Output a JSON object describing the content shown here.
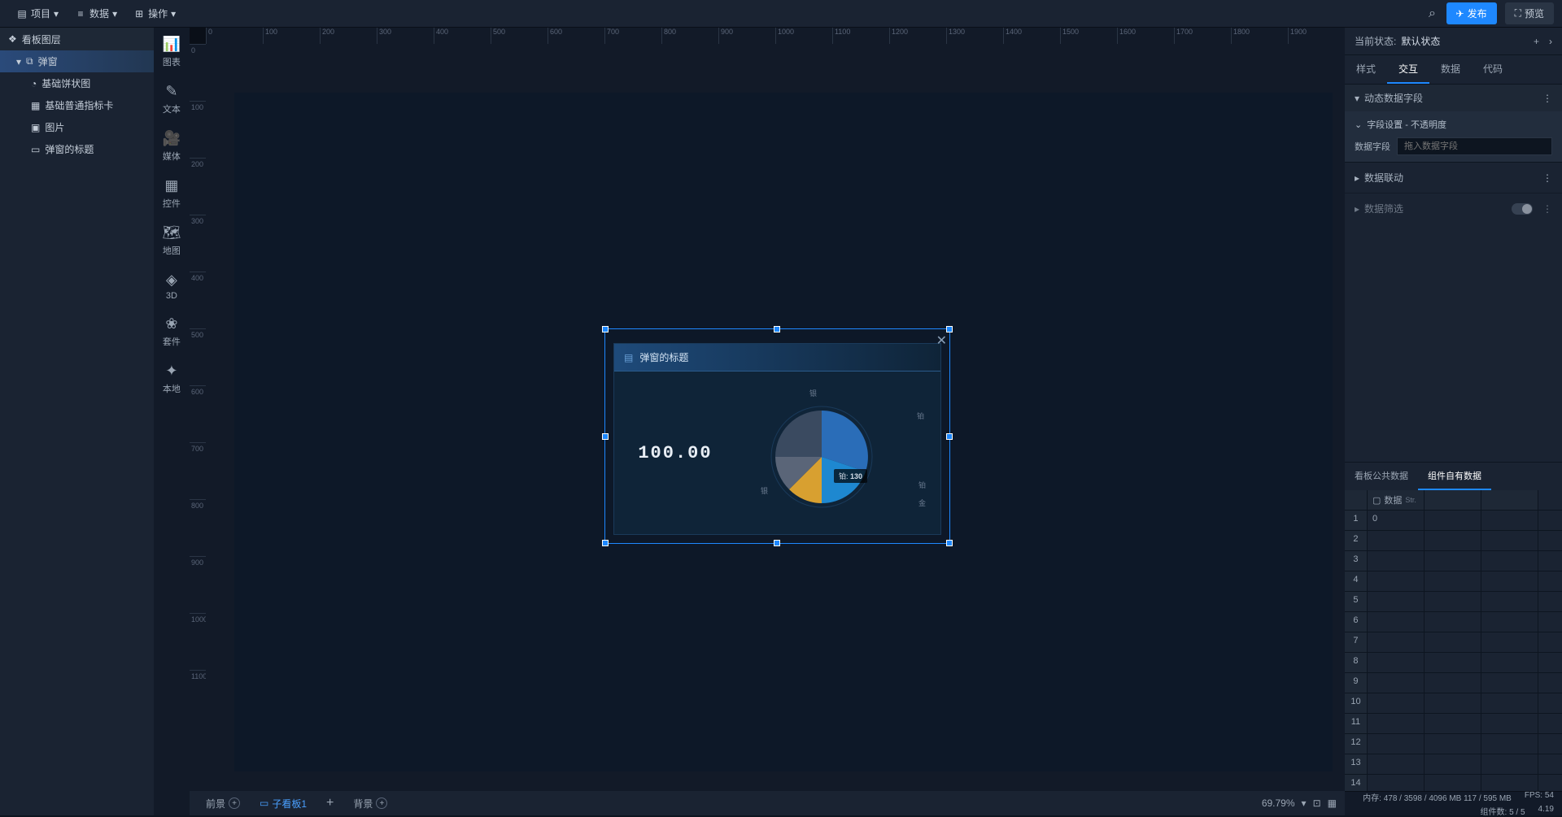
{
  "top_menu": {
    "project": "项目",
    "data": "数据",
    "actions": "操作",
    "publish": "发布",
    "preview": "预览"
  },
  "left_panel": {
    "layers_title": "看板图层",
    "tree": {
      "root": "弹窗",
      "children": [
        "基础饼状图",
        "基础普通指标卡",
        "图片",
        "弹窗的标题"
      ]
    }
  },
  "component_strip": [
    "图表",
    "文本",
    "媒体",
    "控件",
    "地图",
    "3D",
    "套件",
    "本地"
  ],
  "canvas": {
    "ruler_h": [
      "0",
      "100",
      "200",
      "300",
      "400",
      "500",
      "600",
      "700",
      "800",
      "900",
      "1000",
      "1100",
      "1200",
      "1300",
      "1400",
      "1500",
      "1600",
      "1700",
      "1800",
      "1900"
    ],
    "ruler_v": [
      "0",
      "100",
      "200",
      "300",
      "400",
      "500",
      "600",
      "700",
      "800",
      "900",
      "1000",
      "1100"
    ],
    "popup_title": "弹窗的标题",
    "indicator_value": "100.00",
    "pie": {
      "tooltip_label": "铂:",
      "tooltip_value": "130",
      "labels": [
        "银",
        "铂",
        "铂",
        "金",
        "银"
      ]
    }
  },
  "bottom_tabs": {
    "foreground": "前景",
    "sub_board": "子看板1",
    "background": "背景",
    "zoom": "69.79%"
  },
  "right_panel": {
    "state_label": "当前状态:",
    "state_value": "默认状态",
    "tabs": [
      "样式",
      "交互",
      "数据",
      "代码"
    ],
    "section_dynamic": "动态数据字段",
    "sub_section_title": "字段设置 - 不透明度",
    "field_label": "数据字段",
    "field_placeholder": "拖入数据字段",
    "section_link": "数据联动",
    "section_filter": "数据筛选",
    "data_tabs": [
      "看板公共数据",
      "组件自有数据"
    ],
    "grid_header": "数据",
    "grid_header_suffix": "Str.",
    "grid_first_cell": "0",
    "grid_rows": 14
  },
  "status_bar": {
    "memory": "内存:  478 / 3598 / 4096 MB  117 / 595 MB",
    "fps": "FPS:  54",
    "components": "组件数: 5 / 5",
    "version": "4.19"
  },
  "chart_data": {
    "type": "pie",
    "title": "",
    "series": [
      {
        "name": "铂",
        "value": 130
      },
      {
        "name": "银",
        "value": 90
      },
      {
        "name": "金",
        "value": 60
      },
      {
        "name": "铂2",
        "value": 50
      },
      {
        "name": "银2",
        "value": 30
      }
    ],
    "colors": [
      "#2a6db8",
      "#1e88d0",
      "#d8a030",
      "#5a6578",
      "#3a8ac8"
    ]
  }
}
